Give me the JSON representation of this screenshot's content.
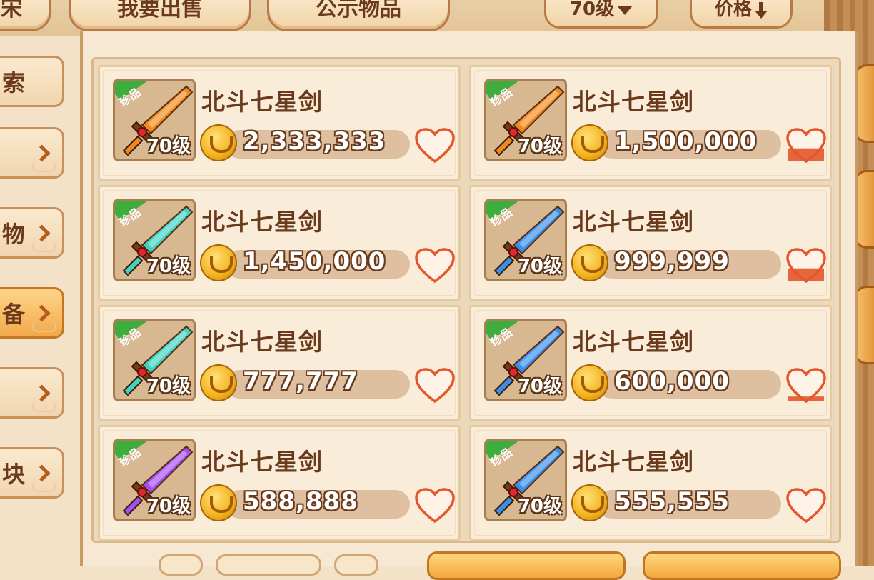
{
  "top_tabs": [
    "宋",
    "我要出售",
    "公示物品"
  ],
  "filters": {
    "level_label": "70级",
    "sort_label": "价格"
  },
  "sidebar": {
    "items": [
      {
        "label": "索",
        "active": false,
        "chevron": false
      },
      {
        "label": "",
        "active": false,
        "chevron": true
      },
      {
        "label": "物",
        "active": false,
        "chevron": true
      },
      {
        "label": "备",
        "active": true,
        "chevron": true
      },
      {
        "label": "",
        "active": false,
        "chevron": true
      },
      {
        "label": "块",
        "active": false,
        "chevron": true
      }
    ]
  },
  "listings": [
    {
      "name": "北斗七星剑",
      "price": "2,333,333",
      "tag": "珍品",
      "level": "70级",
      "sword_color": "#f08a1c",
      "heart_filled": 0
    },
    {
      "name": "北斗七星剑",
      "price": "1,500,000",
      "tag": "珍品",
      "level": "70级",
      "sword_color": "#f08a1c",
      "heart_filled": 0.4
    },
    {
      "name": "北斗七星剑",
      "price": "1,450,000",
      "tag": "珍品",
      "level": "70级",
      "sword_color": "#3fd3c0",
      "heart_filled": 0
    },
    {
      "name": "北斗七星剑",
      "price": "999,999",
      "tag": "珍品",
      "level": "70级",
      "sword_color": "#3a8ee8",
      "heart_filled": 0.4
    },
    {
      "name": "北斗七星剑",
      "price": "777,777",
      "tag": "珍品",
      "level": "70级",
      "sword_color": "#3fd3c0",
      "heart_filled": 0
    },
    {
      "name": "北斗七星剑",
      "price": "600,000",
      "tag": "珍品",
      "level": "70级",
      "sword_color": "#3a8ee8",
      "heart_filled": 0.15
    },
    {
      "name": "北斗七星剑",
      "price": "588,888",
      "tag": "珍品",
      "level": "70级",
      "sword_color": "#a34ef0",
      "heart_filled": 0
    },
    {
      "name": "北斗七星剑",
      "price": "555,555",
      "tag": "珍品",
      "level": "70级",
      "sword_color": "#3a8ee8",
      "heart_filled": 0
    }
  ],
  "colors": {
    "accent": "#f08a1c",
    "text_brown": "#6b3a1c",
    "tag_green": "#3dae3d",
    "heart": "#e3572b"
  }
}
